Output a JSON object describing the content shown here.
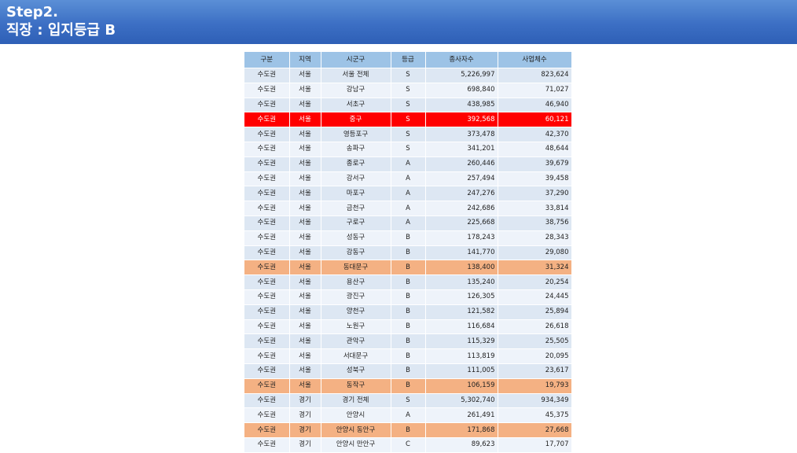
{
  "header": {
    "title_line1": "Step2.",
    "title_line2": "직장 : 입지등급 B"
  },
  "table": {
    "columns": [
      "구분",
      "지역",
      "시군구",
      "등급",
      "종사자수",
      "사업체수"
    ],
    "rows": [
      {
        "구분": "수도권",
        "지역": "서울",
        "시군구": "서울 전체",
        "등급": "S",
        "종사자수": "5,226,997",
        "사업체수": "823,624",
        "highlight": "none",
        "summary": true
      },
      {
        "구분": "수도권",
        "지역": "서울",
        "시군구": "강남구",
        "등급": "S",
        "종사자수": "698,840",
        "사업체수": "71,027",
        "highlight": "none",
        "summary": false
      },
      {
        "구분": "수도권",
        "지역": "서울",
        "시군구": "서초구",
        "등급": "S",
        "종사자수": "438,985",
        "사업체수": "46,940",
        "highlight": "none",
        "summary": false
      },
      {
        "구분": "수도권",
        "지역": "서울",
        "시군구": "중구",
        "등급": "S",
        "종사자수": "392,568",
        "사업체수": "60,121",
        "highlight": "red",
        "summary": false
      },
      {
        "구분": "수도권",
        "지역": "서울",
        "시군구": "영등포구",
        "등급": "S",
        "종사자수": "373,478",
        "사업체수": "42,370",
        "highlight": "none",
        "summary": false
      },
      {
        "구분": "수도권",
        "지역": "서울",
        "시군구": "송파구",
        "등급": "S",
        "종사자수": "341,201",
        "사업체수": "48,644",
        "highlight": "none",
        "summary": false
      },
      {
        "구분": "수도권",
        "지역": "서울",
        "시군구": "종로구",
        "등급": "A",
        "종사자수": "260,446",
        "사업체수": "39,679",
        "highlight": "none",
        "summary": false
      },
      {
        "구분": "수도권",
        "지역": "서울",
        "시군구": "강서구",
        "등급": "A",
        "종사자수": "257,494",
        "사업체수": "39,458",
        "highlight": "none",
        "summary": false
      },
      {
        "구분": "수도권",
        "지역": "서울",
        "시군구": "마포구",
        "등급": "A",
        "종사자수": "247,276",
        "사업체수": "37,290",
        "highlight": "none",
        "summary": false
      },
      {
        "구분": "수도권",
        "지역": "서울",
        "시군구": "금천구",
        "등급": "A",
        "종사자수": "242,686",
        "사업체수": "33,814",
        "highlight": "none",
        "summary": false
      },
      {
        "구분": "수도권",
        "지역": "서울",
        "시군구": "구로구",
        "등급": "A",
        "종사자수": "225,668",
        "사업체수": "38,756",
        "highlight": "none",
        "summary": false
      },
      {
        "구분": "수도권",
        "지역": "서울",
        "시군구": "성동구",
        "등급": "B",
        "종사자수": "178,243",
        "사업체수": "28,343",
        "highlight": "none",
        "summary": false
      },
      {
        "구분": "수도권",
        "지역": "서울",
        "시군구": "강동구",
        "등급": "B",
        "종사자수": "141,770",
        "사업체수": "29,080",
        "highlight": "none",
        "summary": false
      },
      {
        "구분": "수도권",
        "지역": "서울",
        "시군구": "동대문구",
        "등급": "B",
        "종사자수": "138,400",
        "사업체수": "31,324",
        "highlight": "orange",
        "summary": false
      },
      {
        "구분": "수도권",
        "지역": "서울",
        "시군구": "용산구",
        "등급": "B",
        "종사자수": "135,240",
        "사업체수": "20,254",
        "highlight": "none",
        "summary": false
      },
      {
        "구분": "수도권",
        "지역": "서울",
        "시군구": "광진구",
        "등급": "B",
        "종사자수": "126,305",
        "사업체수": "24,445",
        "highlight": "none",
        "summary": false
      },
      {
        "구분": "수도권",
        "지역": "서울",
        "시군구": "양천구",
        "등급": "B",
        "종사자수": "121,582",
        "사업체수": "25,894",
        "highlight": "none",
        "summary": false
      },
      {
        "구분": "수도권",
        "지역": "서울",
        "시군구": "노원구",
        "등급": "B",
        "종사자수": "116,684",
        "사업체수": "26,618",
        "highlight": "none",
        "summary": false
      },
      {
        "구분": "수도권",
        "지역": "서울",
        "시군구": "관악구",
        "등급": "B",
        "종사자수": "115,329",
        "사업체수": "25,505",
        "highlight": "none",
        "summary": false
      },
      {
        "구분": "수도권",
        "지역": "서울",
        "시군구": "서대문구",
        "등급": "B",
        "종사자수": "113,819",
        "사업체수": "20,095",
        "highlight": "none",
        "summary": false
      },
      {
        "구분": "수도권",
        "지역": "서울",
        "시군구": "성북구",
        "등급": "B",
        "종사자수": "111,005",
        "사업체수": "23,617",
        "highlight": "none",
        "summary": false
      },
      {
        "구분": "수도권",
        "지역": "서울",
        "시군구": "동작구",
        "등급": "B",
        "종사자수": "106,159",
        "사업체수": "19,793",
        "highlight": "orange",
        "summary": false
      },
      {
        "구분": "수도권",
        "지역": "경기",
        "시군구": "경기 전체",
        "등급": "S",
        "종사자수": "5,302,740",
        "사업체수": "934,349",
        "highlight": "none",
        "summary": true
      },
      {
        "구분": "수도권",
        "지역": "경기",
        "시군구": "안양시",
        "등급": "A",
        "종사자수": "261,491",
        "사업체수": "45,375",
        "highlight": "none",
        "summary": false
      },
      {
        "구분": "수도권",
        "지역": "경기",
        "시군구": "안양시 동안구",
        "등급": "B",
        "종사자수": "171,868",
        "사업체수": "27,668",
        "highlight": "orange",
        "summary": false
      },
      {
        "구분": "수도권",
        "지역": "경기",
        "시군구": "안양시 만안구",
        "등급": "C",
        "종사자수": "89,623",
        "사업체수": "17,707",
        "highlight": "none",
        "summary": false
      }
    ]
  },
  "colors": {
    "banner": "#3c6fc4",
    "header_row": "#9dc3e6",
    "highlight_red": "#ff0000",
    "highlight_orange": "#f4b183"
  }
}
